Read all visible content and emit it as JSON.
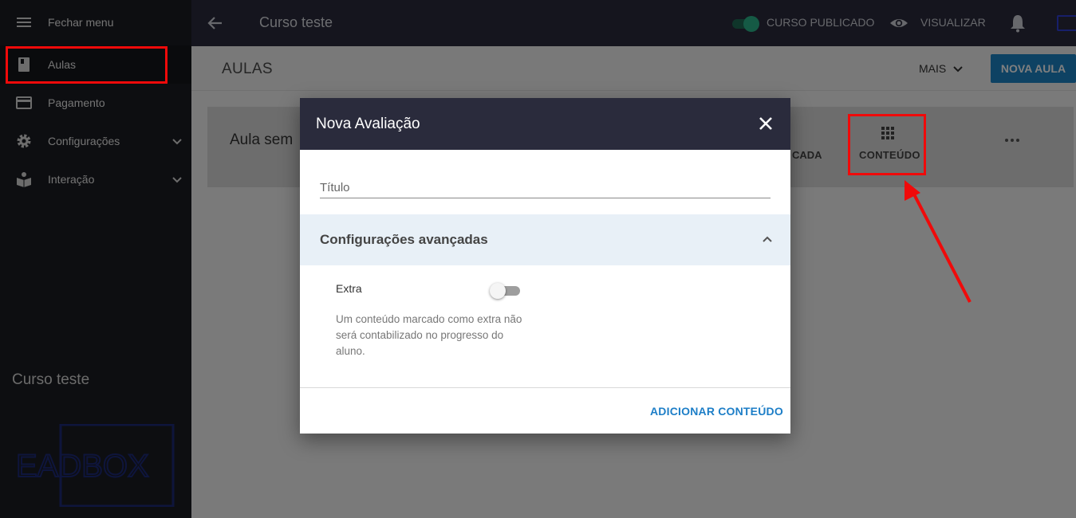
{
  "sidebar": {
    "close_menu_label": "Fechar menu",
    "items": [
      {
        "label": "Aulas",
        "icon": "book-icon"
      },
      {
        "label": "Pagamento",
        "icon": "credit-card-icon"
      },
      {
        "label": "Configurações",
        "icon": "gear-icon"
      },
      {
        "label": "Interação",
        "icon": "interaction-icon"
      }
    ],
    "footer_title": "Curso teste",
    "logo_text": "EADBOX"
  },
  "topbar": {
    "title": "Curso teste",
    "published_label": "CURSO PUBLICADO",
    "published": true,
    "view_label": "VISUALIZAR"
  },
  "page": {
    "heading": "AULAS",
    "more_label": "MAIS",
    "new_lesson_label": "NOVA AULA"
  },
  "lesson_card": {
    "title": "Aula sem",
    "partial_label": "CADA",
    "content_label": "CONTEÚDO"
  },
  "modal": {
    "title": "Nova Avaliação",
    "title_placeholder": "Título",
    "advanced_label": "Configurações avançadas",
    "extra_label": "Extra",
    "extra_on": false,
    "extra_description": "Um conteúdo marcado como extra não será contabilizado no progresso do aluno.",
    "add_content_label": "ADICIONAR CONTEÚDO"
  },
  "colors": {
    "accent": "#1d84c7",
    "highlight": "#f00a0a",
    "topbar": "#2a2b3c",
    "sidebar": "#1b1c22"
  }
}
